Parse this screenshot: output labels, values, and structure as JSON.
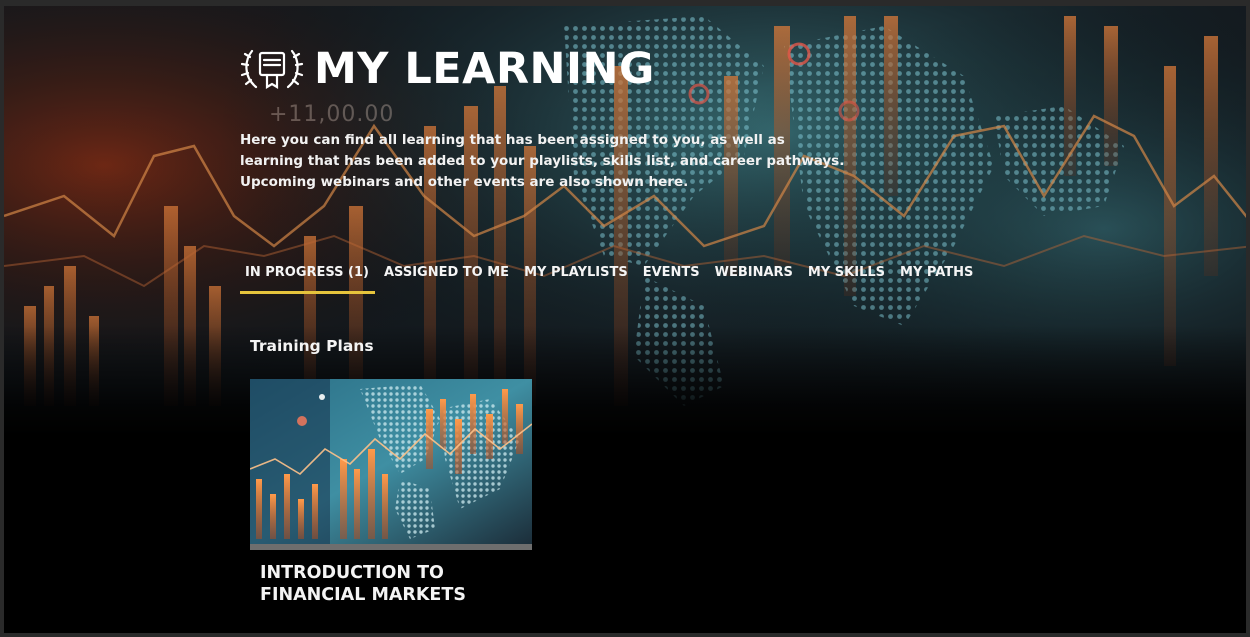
{
  "header": {
    "title": "MY LEARNING",
    "icon": "certificate-laurel-icon",
    "ghost_number": "+11,00.00",
    "intro_lines": [
      "Here you can find all learning that has been assigned to you, as well as",
      "learning that has been added to your playlists, skills list, and career pathways.",
      "Upcoming webinars and other events are also shown here."
    ]
  },
  "tabs": [
    {
      "label": "IN PROGRESS (1)",
      "active": true
    },
    {
      "label": "ASSIGNED TO ME",
      "active": false
    },
    {
      "label": "MY PLAYLISTS",
      "active": false
    },
    {
      "label": "EVENTS",
      "active": false
    },
    {
      "label": "WEBINARS",
      "active": false
    },
    {
      "label": "MY SKILLS",
      "active": false
    },
    {
      "label": "MY PATHS",
      "active": false
    }
  ],
  "section": {
    "title": "Training Plans"
  },
  "cards": [
    {
      "title": "INTRODUCTION TO FINANCIAL MARKETS",
      "thumbnail": "financial-markets-world-map-image"
    }
  ],
  "colors": {
    "accent_underline": "#e6c43c",
    "background": "#000000",
    "text": "#ffffff"
  }
}
